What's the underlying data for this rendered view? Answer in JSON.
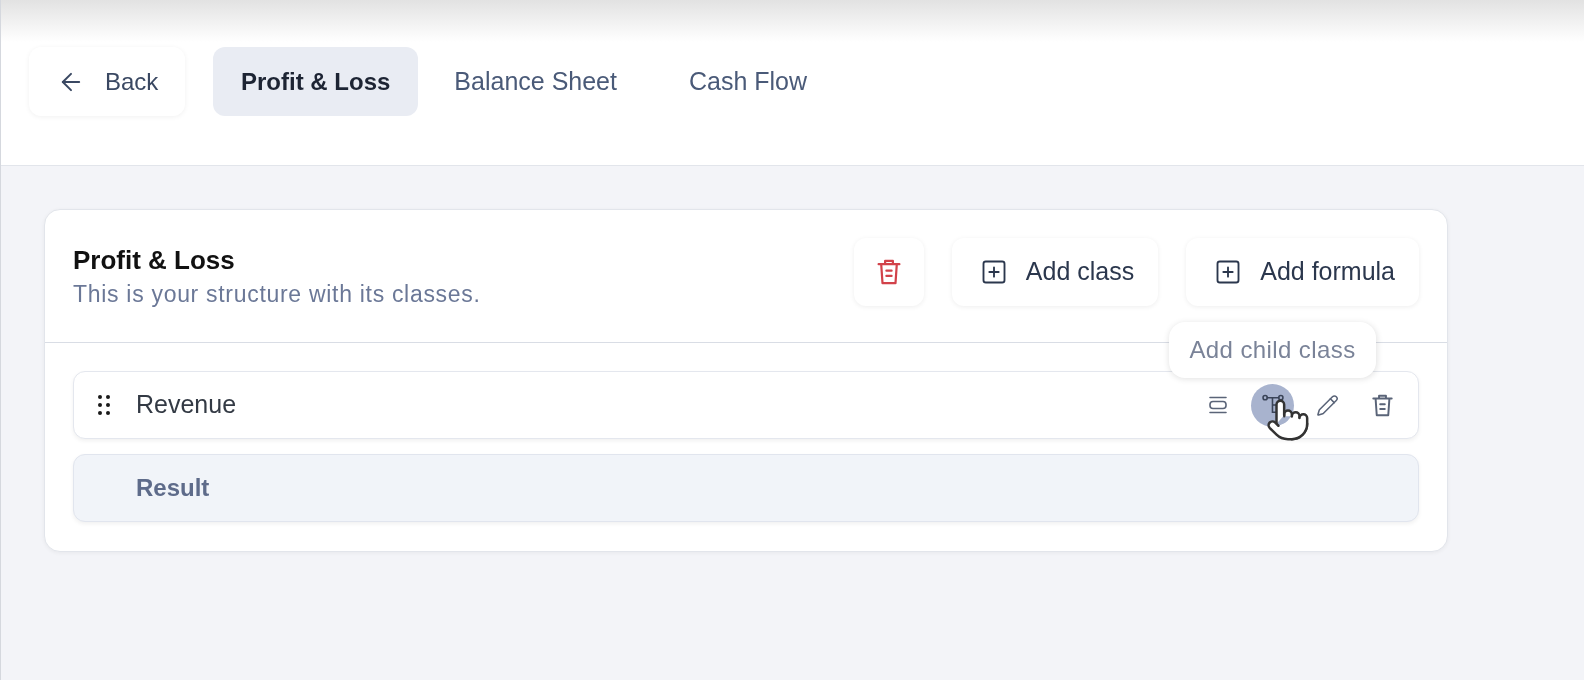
{
  "nav": {
    "back": {
      "label": "Back"
    },
    "tabs": [
      {
        "label": "Profit & Loss",
        "selected": true
      },
      {
        "label": "Balance Sheet",
        "selected": false
      },
      {
        "label": "Cash Flow",
        "selected": false
      }
    ]
  },
  "card": {
    "title": "Profit & Loss",
    "subtitle": "This is your structure with its classes.",
    "buttons": [
      {
        "kind": "delete"
      },
      {
        "kind": "add",
        "label": "Add class"
      },
      {
        "kind": "add",
        "label": "Add formula"
      }
    ],
    "rows": [
      {
        "kind": "class",
        "label": "Revenue",
        "actions": [
          {
            "kind": "lines",
            "highlighted": false
          },
          {
            "kind": "tree",
            "highlighted": true,
            "tooltip": "Add child class"
          },
          {
            "kind": "pencil",
            "highlighted": false
          },
          {
            "kind": "trash",
            "highlighted": false
          }
        ]
      },
      {
        "kind": "result",
        "label": "Result"
      }
    ]
  }
}
